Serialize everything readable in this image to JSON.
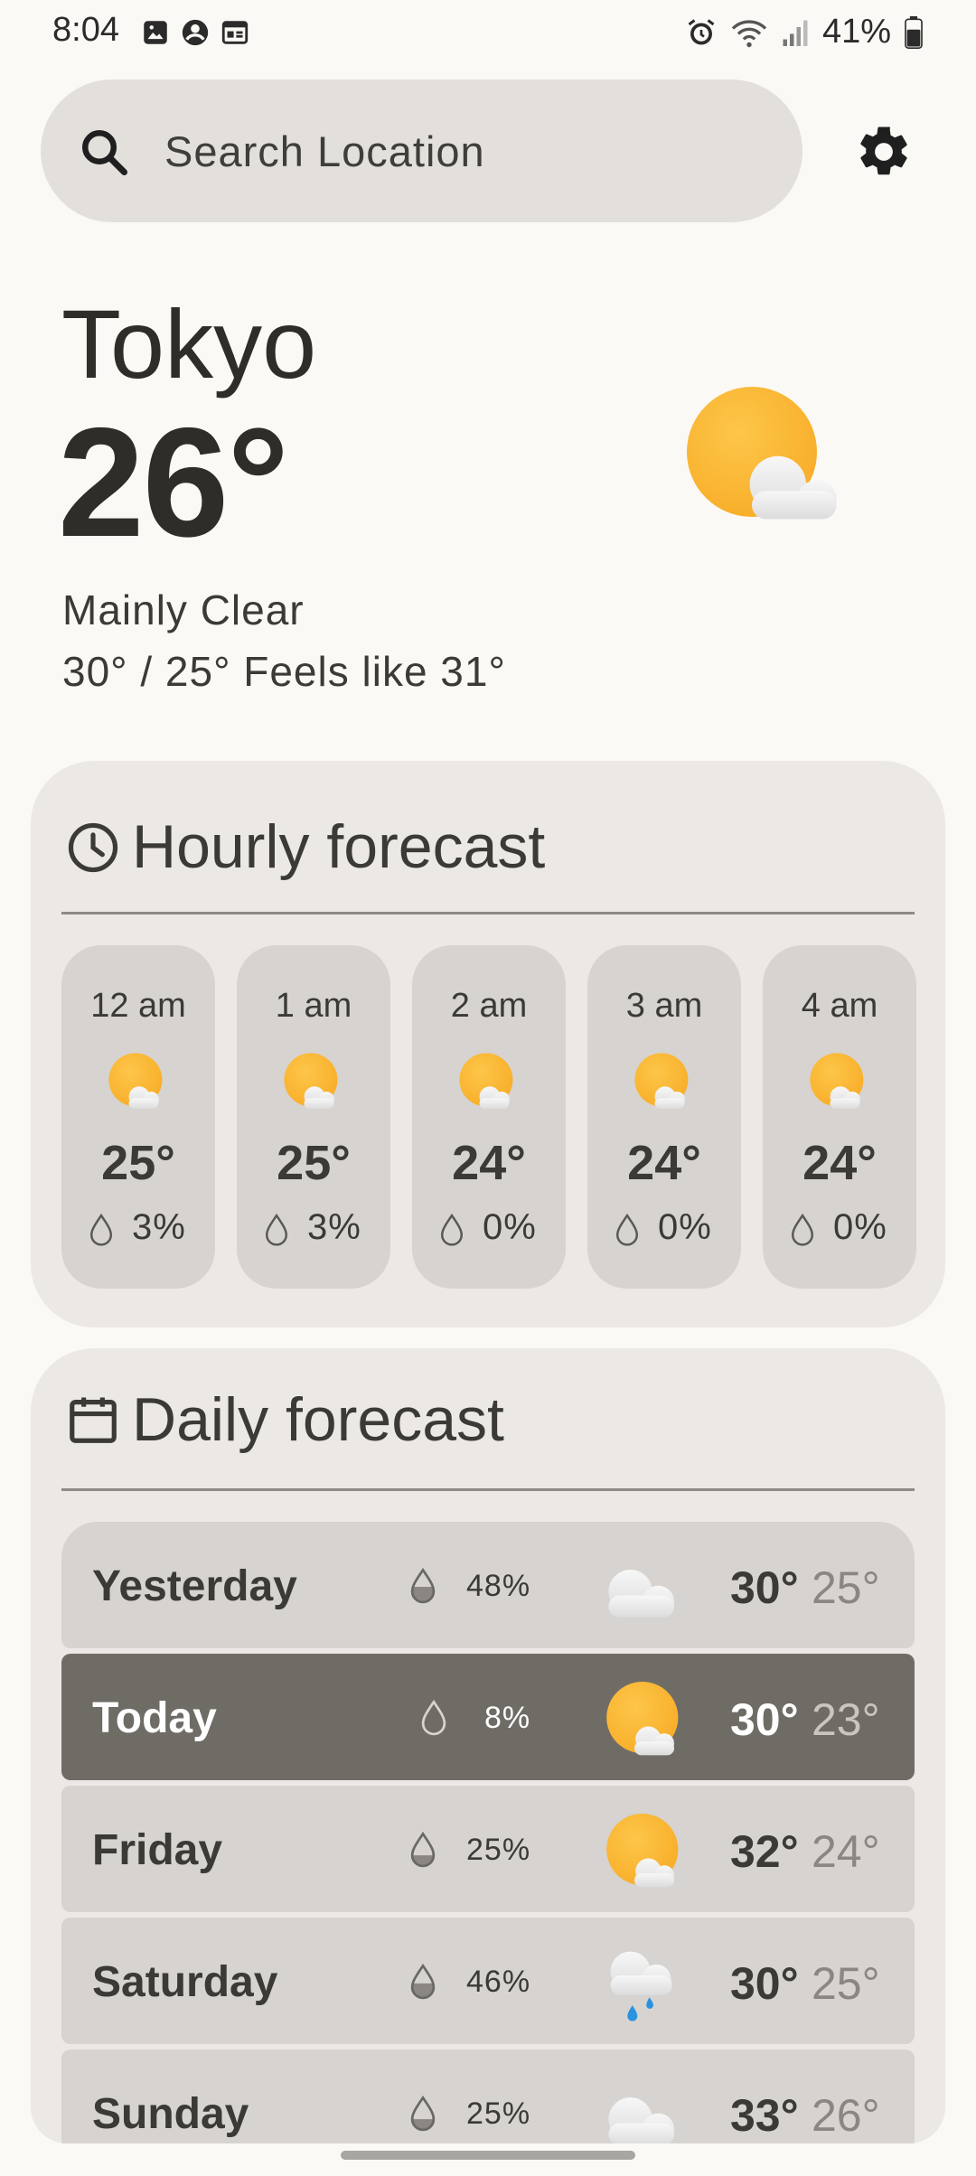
{
  "status_bar": {
    "time": "8:04",
    "battery_percent": "41%",
    "left_icons": [
      "image-icon",
      "account-circle-icon",
      "calendar-card-icon"
    ],
    "right_icons": [
      "alarm-icon",
      "wifi-icon",
      "signal-icon",
      "battery-icon"
    ]
  },
  "search": {
    "placeholder": "Search Location"
  },
  "current": {
    "city": "Tokyo",
    "temperature": "26°",
    "condition": "Mainly Clear",
    "high_low_feels": "30° / 25° Feels like 31°",
    "icon": "sun-behind-cloud-icon"
  },
  "hourly": {
    "title": "Hourly forecast",
    "items": [
      {
        "time": "12 am",
        "temp": "25°",
        "precip": "3%",
        "icon": "sun-behind-cloud-icon"
      },
      {
        "time": "1 am",
        "temp": "25°",
        "precip": "3%",
        "icon": "sun-behind-cloud-icon"
      },
      {
        "time": "2 am",
        "temp": "24°",
        "precip": "0%",
        "icon": "sun-behind-cloud-icon"
      },
      {
        "time": "3 am",
        "temp": "24°",
        "precip": "0%",
        "icon": "sun-behind-cloud-icon"
      },
      {
        "time": "4 am",
        "temp": "24°",
        "precip": "0%",
        "icon": "sun-behind-cloud-icon"
      }
    ]
  },
  "daily": {
    "title": "Daily forecast",
    "items": [
      {
        "day": "Yesterday",
        "precip": "48%",
        "high": "30°",
        "low": "25°",
        "icon": "cloud-icon"
      },
      {
        "day": "Today",
        "precip": "8%",
        "high": "30°",
        "low": "23°",
        "icon": "sun-behind-cloud-icon"
      },
      {
        "day": "Friday",
        "precip": "25%",
        "high": "32°",
        "low": "24°",
        "icon": "sun-behind-cloud-icon"
      },
      {
        "day": "Saturday",
        "precip": "46%",
        "high": "30°",
        "low": "25°",
        "icon": "rain-cloud-icon"
      },
      {
        "day": "Sunday",
        "precip": "25%",
        "high": "33°",
        "low": "26°",
        "icon": "cloud-icon"
      }
    ]
  },
  "colors": {
    "background": "#fbf9f5",
    "card": "#ebe8e5",
    "tile": "#d6d3d0",
    "selected_row": "#6f6c66",
    "sun": "#fbb632"
  }
}
